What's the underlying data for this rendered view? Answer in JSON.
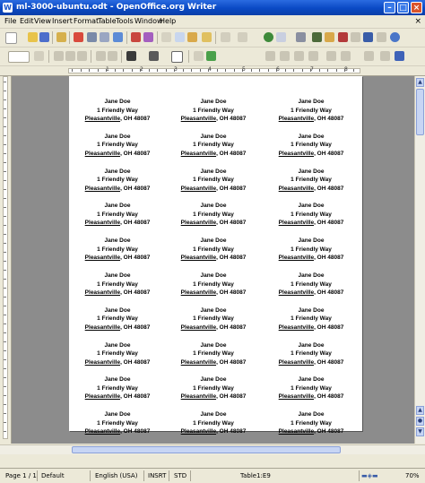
{
  "window": {
    "title": "ml-3000-ubuntu.odt - OpenOffice.org Writer"
  },
  "menu": [
    "File",
    "Edit",
    "View",
    "Insert",
    "Format",
    "Table",
    "Tools",
    "Window",
    "Help"
  ],
  "labels": {
    "name": "Jane Doe",
    "street": "1 Friendly Way",
    "city": "Pleasantville",
    "state_zip": ", OH 48087",
    "rows": 10,
    "columns": 3
  },
  "ruler_numbers": [
    "1",
    "2",
    "3",
    "4",
    "5",
    "6",
    "7",
    "8"
  ],
  "status": {
    "page": "Page 1 / 1",
    "style": "Default",
    "language": "English (USA)",
    "insert_mode": "INSRT",
    "selection_mode": "STD",
    "cell": "Table1:E9",
    "zoom": "70%"
  }
}
